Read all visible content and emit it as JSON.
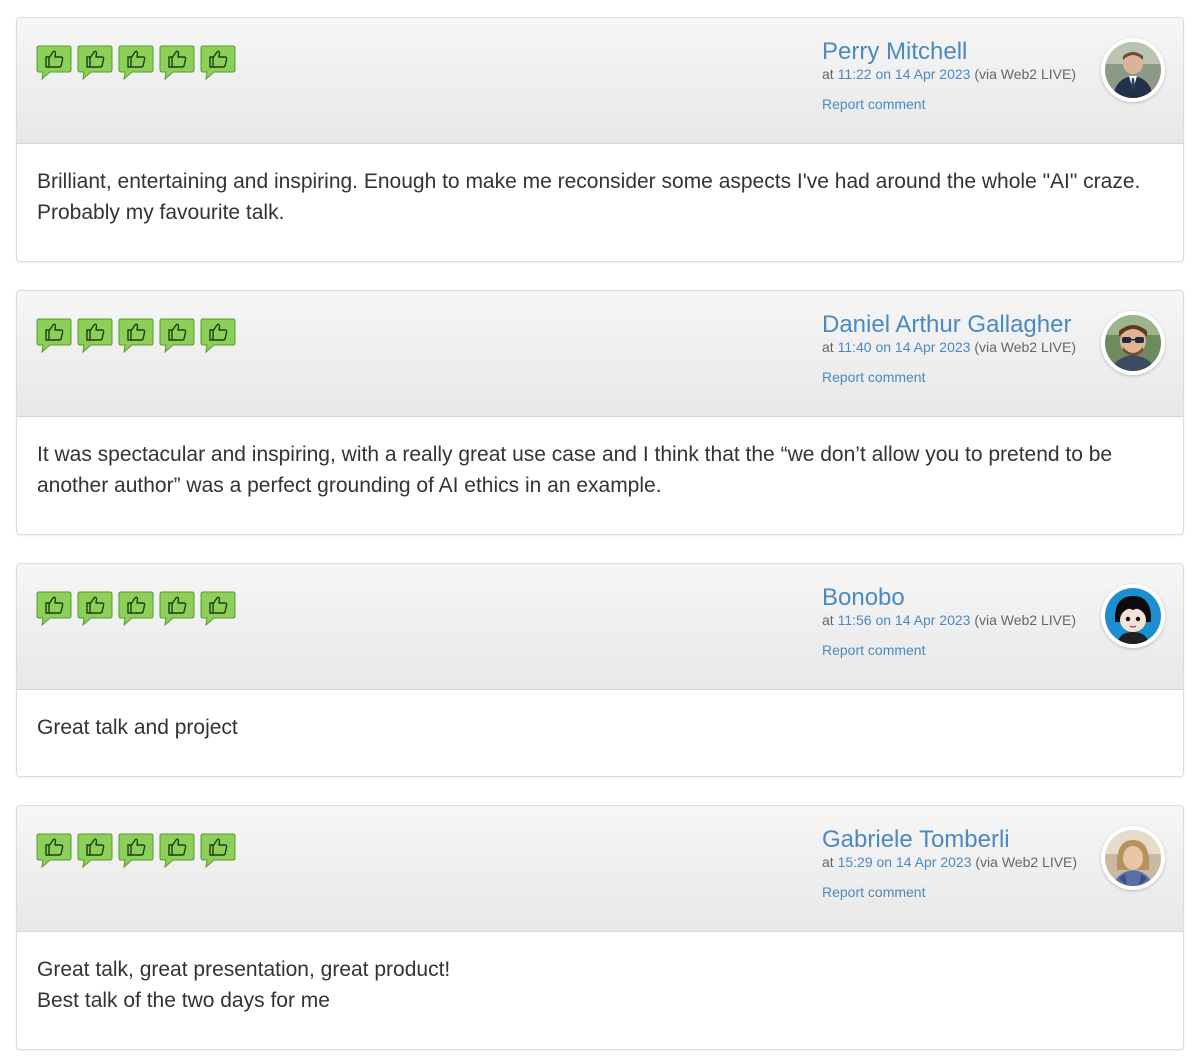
{
  "comments": [
    {
      "author": "Perry Mitchell",
      "at_prefix": "at",
      "time_link": "11:22 on 14 Apr 2023",
      "via": "(via Web2 LIVE)",
      "report_label": "Report comment",
      "rating": 5,
      "avatar_icon": "person-photo-avatar",
      "body": "Brilliant, entertaining and inspiring. Enough to make me reconsider some aspects I've had around the whole \"AI\" craze. Probably my favourite talk."
    },
    {
      "author": "Daniel Arthur Gallagher",
      "at_prefix": "at",
      "time_link": "11:40 on 14 Apr 2023",
      "via": "(via Web2 LIVE)",
      "report_label": "Report comment",
      "rating": 5,
      "avatar_icon": "person-with-sunglasses-avatar",
      "body": "It was spectacular and inspiring, with a really great use case and I think that the “we don’t allow you to pretend to be another author” was a perfect grounding of AI ethics in an example."
    },
    {
      "author": "Bonobo",
      "at_prefix": "at",
      "time_link": "11:56 on 14 Apr 2023",
      "via": "(via Web2 LIVE)",
      "report_label": "Report comment",
      "rating": 5,
      "avatar_icon": "cartoon-character-avatar",
      "body": "Great talk and project"
    },
    {
      "author": "Gabriele Tomberli",
      "at_prefix": "at",
      "time_link": "15:29 on 14 Apr 2023",
      "via": "(via Web2 LIVE)",
      "report_label": "Report comment",
      "rating": 5,
      "avatar_icon": "person-photo-avatar",
      "body": "Great talk, great presentation, great product!\nBest talk of the two days for me"
    }
  ],
  "colors": {
    "link": "#4a89c2",
    "thumb_green": "#8cd05a",
    "thumb_border": "#5a9a2e",
    "header_top": "#f6f6f6",
    "header_bottom": "#e8e8e8"
  }
}
